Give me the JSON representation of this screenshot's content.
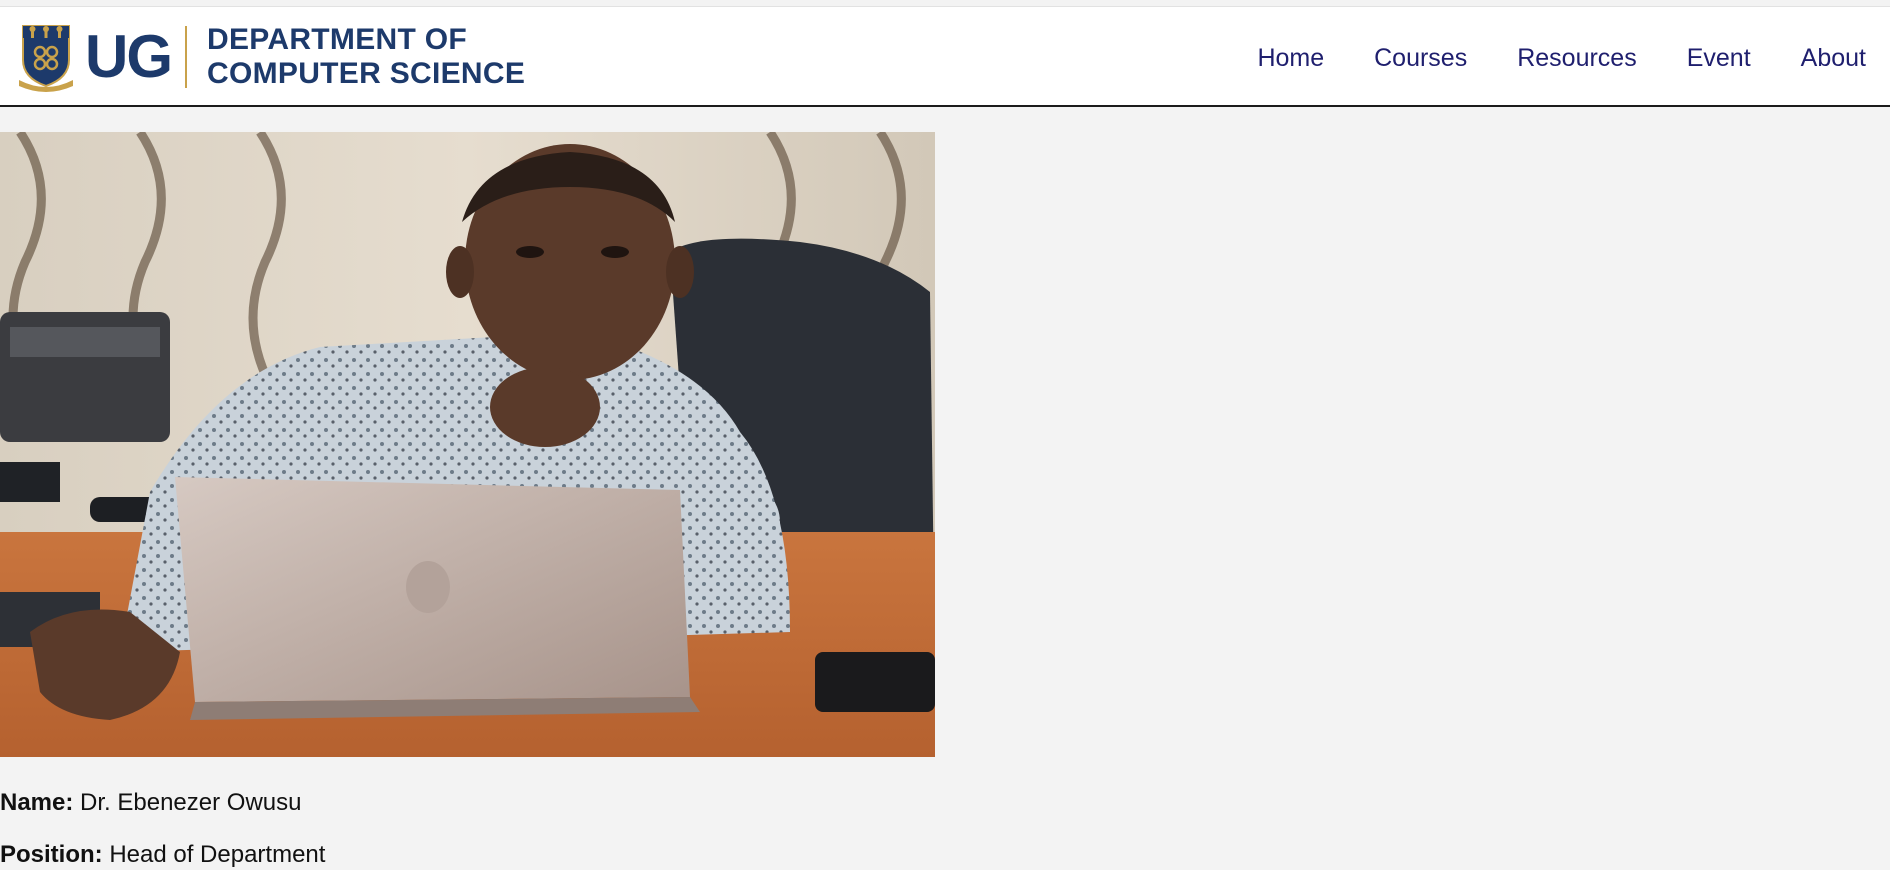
{
  "header": {
    "logo": {
      "wordmark": "UG",
      "crest_icon": "university-crest-icon"
    },
    "dept_line1": "DEPARTMENT OF",
    "dept_line2": "COMPUTER SCIENCE",
    "nav": [
      {
        "label": "Home"
      },
      {
        "label": "Courses"
      },
      {
        "label": "Resources"
      },
      {
        "label": "Event"
      },
      {
        "label": "About"
      }
    ]
  },
  "profile": {
    "photo_desc_icon": "profile-photo",
    "name_label": "Name:",
    "name_value": "Dr. Ebenezer Owusu",
    "position_label": "Position:",
    "position_value": "Head of Department"
  },
  "colors": {
    "brand_navy": "#1d3a6b",
    "nav_link": "#1f1f6e",
    "crest_gold": "#c9a24b",
    "page_bg": "#f3f3f3"
  }
}
